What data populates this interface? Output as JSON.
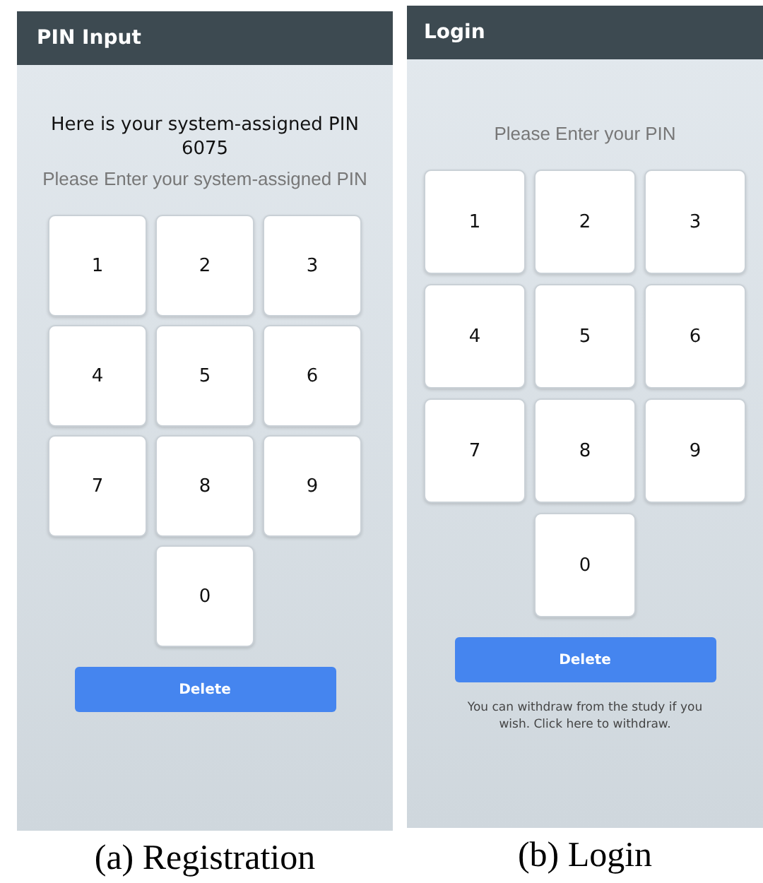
{
  "panels": [
    {
      "title": "PIN Input",
      "heading": "Here is your system-assigned PIN",
      "pin": "6075",
      "prompt": "Please Enter your system-assigned PIN",
      "keys": [
        "1",
        "2",
        "3",
        "4",
        "5",
        "6",
        "7",
        "8",
        "9",
        "0"
      ],
      "delete_button": "Delete",
      "caption": "(a) Registration"
    },
    {
      "title": "Login",
      "prompt": "Please Enter your PIN",
      "keys": [
        "1",
        "2",
        "3",
        "4",
        "5",
        "6",
        "7",
        "8",
        "9",
        "0"
      ],
      "delete_button": "Delete",
      "note": "You can withdraw from the study if you wish. Click here to withdraw.",
      "caption": "(b) Login"
    }
  ]
}
